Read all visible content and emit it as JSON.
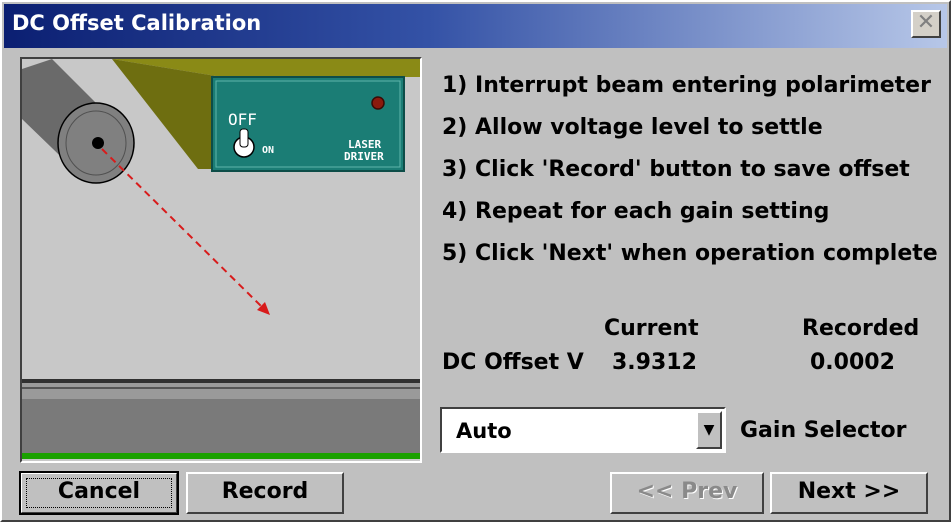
{
  "window": {
    "title": "DC Offset Calibration",
    "close_glyph": "✕"
  },
  "illustration": {
    "switch_off_label": "OFF",
    "switch_on_label": "ON",
    "laser_driver_label_1": "LASER",
    "laser_driver_label_2": "DRIVER"
  },
  "instructions": [
    "1) Interrupt beam entering polarimeter",
    "2) Allow voltage level to settle",
    "3) Click 'Record' button to save offset",
    "4) Repeat for each gain setting",
    "5) Click 'Next' when operation complete"
  ],
  "readout": {
    "current_header": "Current",
    "recorded_header": "Recorded",
    "row_label": "DC Offset V",
    "current_value": "3.9312",
    "recorded_value": "0.0002"
  },
  "gain": {
    "selected": "Auto",
    "label": "Gain Selector",
    "arrow_glyph": "▼"
  },
  "buttons": {
    "cancel": "Cancel",
    "record": "Record",
    "prev": "<< Prev",
    "next": "Next >>"
  },
  "colors": {
    "title_bar_start": "#0b1f72",
    "panel_teal": "#1b7d75",
    "olive": "#8a8a16",
    "beam_red": "#d81b1b",
    "rail_green": "#1aa000"
  }
}
